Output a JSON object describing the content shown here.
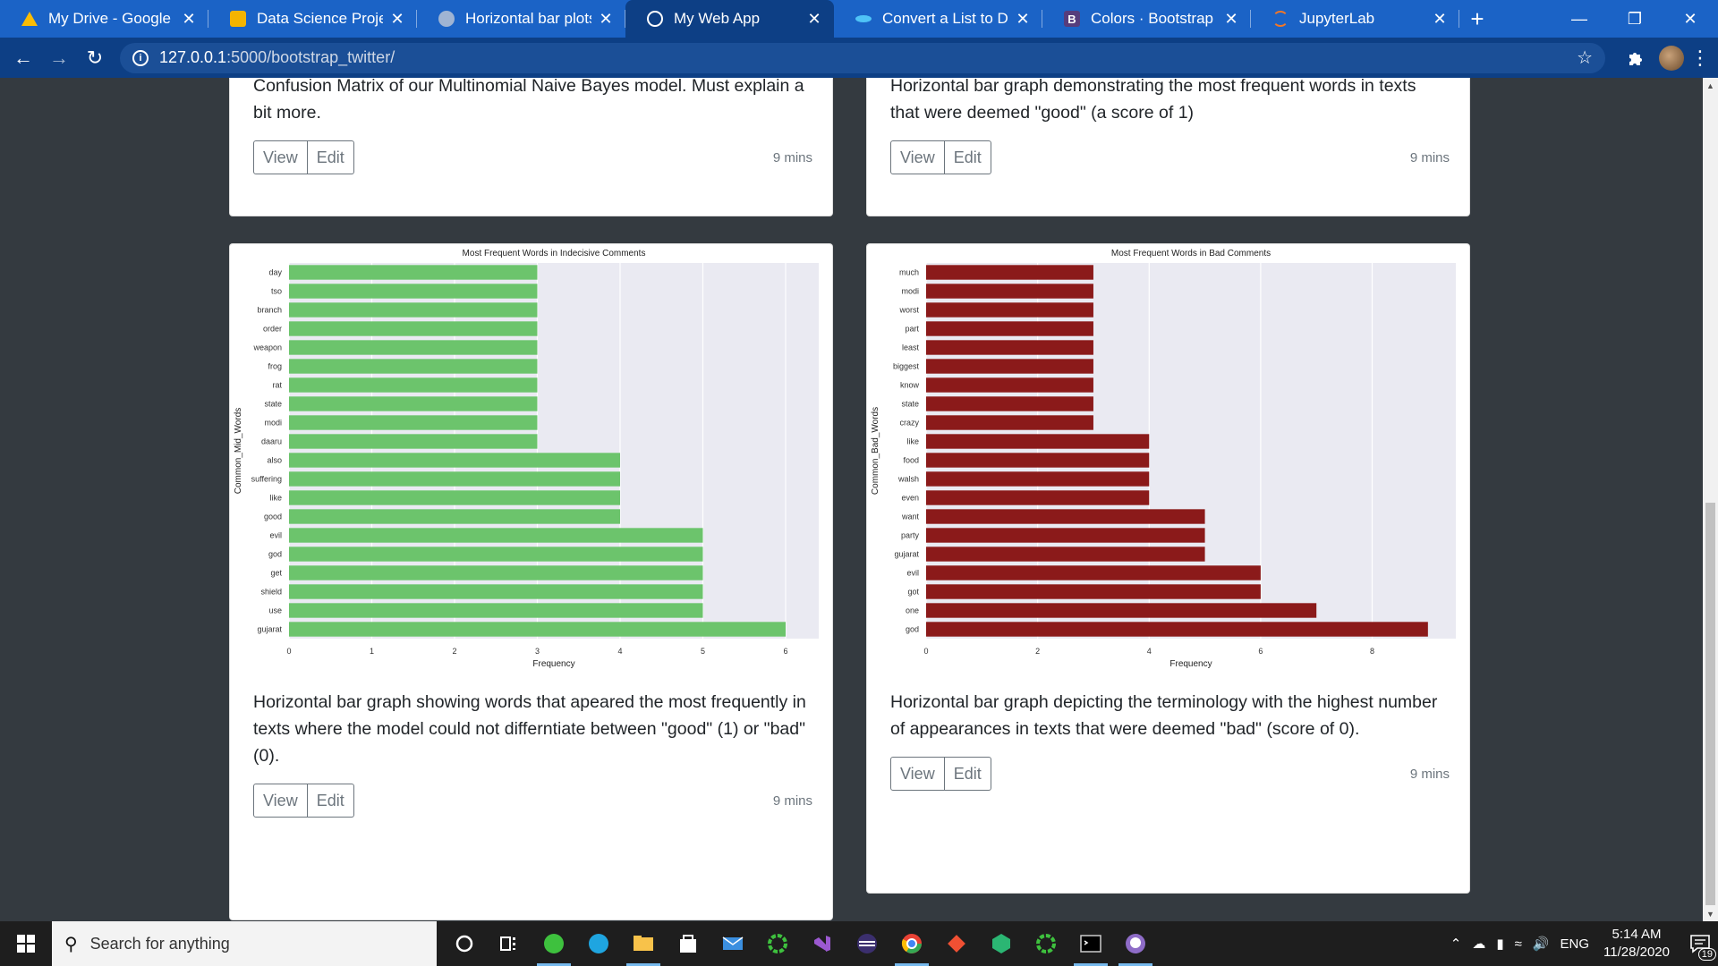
{
  "browser": {
    "tabs": [
      {
        "title": "My Drive - Google Driv",
        "icon": "google-drive-icon",
        "active": false,
        "color": "#fbbc04"
      },
      {
        "title": "Data Science Project Pl",
        "icon": "google-slides-icon",
        "active": false,
        "color": "#f4b400"
      },
      {
        "title": "Horizontal bar plots —",
        "icon": "seaborn-icon",
        "active": false,
        "color": "#9fb4d3"
      },
      {
        "title": "My Web App",
        "icon": "globe-icon",
        "active": true,
        "color": "#ffffff"
      },
      {
        "title": "Convert a List to Dataf",
        "icon": "geeks-icon",
        "active": false,
        "color": "#4fc3f7"
      },
      {
        "title": "Colors · Bootstrap",
        "icon": "bootstrap-icon",
        "active": false,
        "color": "#563d7c"
      },
      {
        "title": "JupyterLab",
        "icon": "jupyter-icon",
        "active": false,
        "color": "#f37726"
      }
    ],
    "url_host": "127.0.0.1",
    "url_rest": ":5000/bootstrap_twitter/"
  },
  "cards": {
    "top_left": {
      "text": "Confusion Matrix of our Multinomial Naive Bayes model. Must explain a bit more.",
      "view": "View",
      "edit": "Edit",
      "time": "9 mins"
    },
    "top_right": {
      "text": "Horizontal bar graph demonstrating the most frequent words in texts that were deemed \"good\" (a score of 1)",
      "view": "View",
      "edit": "Edit",
      "time": "9 mins"
    },
    "bottom_left": {
      "text": "Horizontal bar graph showing words that apeared the most frequently in texts where the model could not differntiate between \"good\" (1) or \"bad\" (0).",
      "view": "View",
      "edit": "Edit",
      "time": "9 mins"
    },
    "bottom_right": {
      "text": "Horizontal bar graph depicting the terminology with the highest number of appearances in texts that were deemed \"bad\" (score of 0).",
      "view": "View",
      "edit": "Edit",
      "time": "9 mins"
    }
  },
  "chart_data": [
    {
      "type": "bar",
      "orientation": "horizontal",
      "title": "Most Frequent Words in Indecisive Comments",
      "xlabel": "Frequency",
      "ylabel": "Common_Mid_Words",
      "categories": [
        "day",
        "tso",
        "branch",
        "order",
        "weapon",
        "frog",
        "rat",
        "state",
        "modi",
        "daaru",
        "also",
        "suffering",
        "like",
        "good",
        "evil",
        "god",
        "get",
        "shield",
        "use",
        "gujarat"
      ],
      "values": [
        3,
        3,
        3,
        3,
        3,
        3,
        3,
        3,
        3,
        3,
        4,
        4,
        4,
        4,
        5,
        5,
        5,
        5,
        5,
        6
      ],
      "xlim": [
        0,
        6.4
      ],
      "xticks": [
        0,
        1,
        2,
        3,
        4,
        5,
        6
      ],
      "color": "#6cc46c",
      "background": "#eaeaf2",
      "grid": true
    },
    {
      "type": "bar",
      "orientation": "horizontal",
      "title": "Most Frequent Words in Bad Comments",
      "xlabel": "Frequency",
      "ylabel": "Common_Bad_Words",
      "categories": [
        "much",
        "modi",
        "worst",
        "part",
        "least",
        "biggest",
        "know",
        "state",
        "crazy",
        "like",
        "food",
        "walsh",
        "even",
        "want",
        "party",
        "gujarat",
        "evil",
        "got",
        "one",
        "god"
      ],
      "values": [
        3,
        3,
        3,
        3,
        3,
        3,
        3,
        3,
        3,
        4,
        4,
        4,
        4,
        5,
        5,
        5,
        6,
        6,
        7,
        9
      ],
      "xlim": [
        0,
        9.5
      ],
      "xticks": [
        0,
        2,
        4,
        6,
        8
      ],
      "color": "#8b1a1a",
      "background": "#eaeaf2",
      "grid": true
    }
  ],
  "taskbar": {
    "search_placeholder": "Search for anything",
    "lang": "ENG",
    "time": "5:14 AM",
    "date": "11/28/2020",
    "notif_count": "19"
  }
}
